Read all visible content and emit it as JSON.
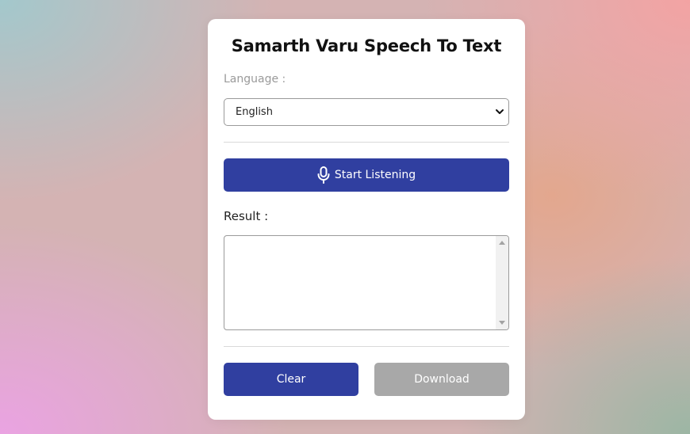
{
  "app": {
    "title": "Samarth Varu Speech To Text"
  },
  "language": {
    "label": "Language :",
    "selected": "English",
    "options": [
      "English"
    ]
  },
  "listen_button": {
    "label": "Start Listening",
    "icon": "microphone-icon"
  },
  "result": {
    "label": "Result :",
    "value": ""
  },
  "actions": {
    "clear_label": "Clear",
    "download_label": "Download"
  },
  "colors": {
    "primary": "#303fa0",
    "disabled": "#a8a8a8"
  }
}
